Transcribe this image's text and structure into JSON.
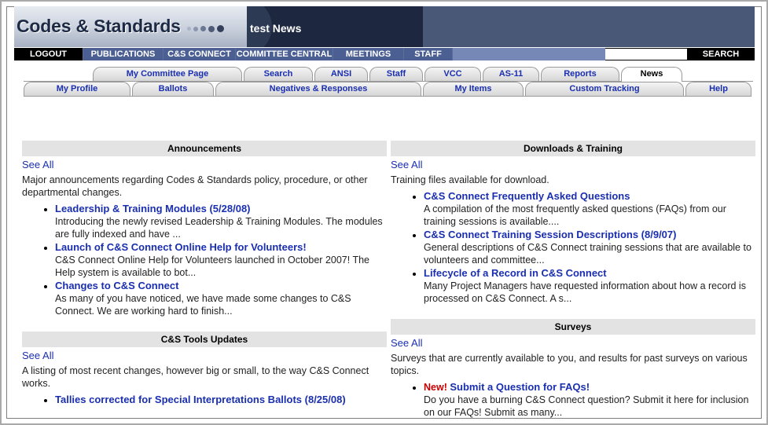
{
  "header": {
    "logo": "Codes & Standards",
    "title": "test News"
  },
  "topnav": {
    "items": [
      "LOGOUT",
      "PUBLICATIONS",
      "C&S CONNECT",
      "COMMITTEE CENTRAL",
      "MEETINGS",
      "STAFF"
    ],
    "search_label": "SEARCH",
    "search_value": ""
  },
  "tabs_row1": [
    "My Committee Page",
    "Search",
    "ANSI",
    "Staff",
    "VCC",
    "AS-11",
    "Reports",
    "News"
  ],
  "tabs_row2": [
    "My Profile",
    "Ballots",
    "Negatives & Responses",
    "My Items",
    "Custom Tracking",
    "Help"
  ],
  "active_tab": "News",
  "announcements": {
    "heading": "Announcements",
    "see_all": "See All",
    "description": "Major announcements regarding Codes & Standards policy, procedure, or other departmental changes.",
    "items": [
      {
        "title": "Leadership & Training Modules (5/28/08)",
        "text": "Introducing the newly revised Leadership & Training Modules. The modules are fully indexed and have ..."
      },
      {
        "title": "Launch of C&S Connect Online Help for Volunteers!",
        "text": "C&S Connect Online Help for Volunteers launched in October 2007! The Help system is available to bot..."
      },
      {
        "title": "Changes to C&S Connect",
        "text": "As many of you have noticed, we have made some changes to C&S Connect. We are working hard to finish..."
      }
    ]
  },
  "tools_updates": {
    "heading": "C&S Tools Updates",
    "see_all": "See All",
    "description": "A listing of most recent changes, however big or small, to the way C&S Connect works.",
    "items": [
      {
        "title": "Tallies corrected for Special Interpretations Ballots (8/25/08)"
      }
    ]
  },
  "downloads": {
    "heading": "Downloads & Training",
    "see_all": "See All",
    "description": "Training files available for download.",
    "items": [
      {
        "title": "C&S Connect Frequently Asked Questions",
        "text": "A compilation of the most frequently asked questions (FAQs) from our training sessions is available...."
      },
      {
        "title": "C&S Connect Training Session Descriptions (8/9/07)",
        "text": "General descriptions of C&S Connect training sessions that are available to volunteers and committee..."
      },
      {
        "title": "Lifecycle of a Record in C&S Connect",
        "text": "Many Project Managers have requested information about how a record is processed on C&S Connect. A s..."
      }
    ]
  },
  "surveys": {
    "heading": "Surveys",
    "see_all": "See All",
    "description": "Surveys that are currently available to you, and results for past surveys on various topics.",
    "items": [
      {
        "new_label": "New!",
        "title": "Submit a Question for FAQs!",
        "text": "Do you have a burning C&S Connect question? Submit it here for inclusion on our FAQs! Submit as many..."
      }
    ]
  }
}
